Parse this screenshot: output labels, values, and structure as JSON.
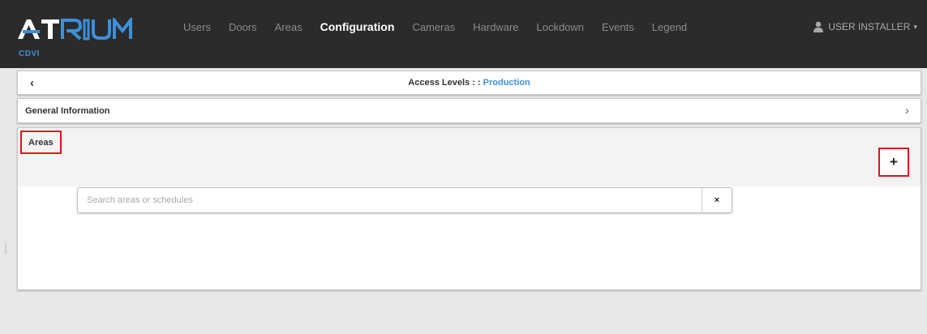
{
  "app": {
    "logo_text": "ATRIUM",
    "logo_sub": "CDVI",
    "logo_color": "#ffffff",
    "accent_color": "#3d8fd8"
  },
  "nav": {
    "items": [
      {
        "label": "Users",
        "active": false
      },
      {
        "label": "Doors",
        "active": false
      },
      {
        "label": "Areas",
        "active": false
      },
      {
        "label": "Configuration",
        "active": true
      },
      {
        "label": "Cameras",
        "active": false
      },
      {
        "label": "Hardware",
        "active": false
      },
      {
        "label": "Lockdown",
        "active": false
      },
      {
        "label": "Events",
        "active": false
      },
      {
        "label": "Legend",
        "active": false
      }
    ],
    "user_label": "USER INSTALLER",
    "user_icon": "user-icon"
  },
  "header": {
    "back_glyph": "‹",
    "title_prefix": "Access Levels : : ",
    "title_link": "Production"
  },
  "general": {
    "label": "General Information",
    "chevron": "›"
  },
  "areas": {
    "label": "Areas",
    "add_label": "+",
    "highlight_color": "#e0141e",
    "search": {
      "placeholder": "Search areas or schedules",
      "value": "",
      "clear_label": "×"
    }
  }
}
